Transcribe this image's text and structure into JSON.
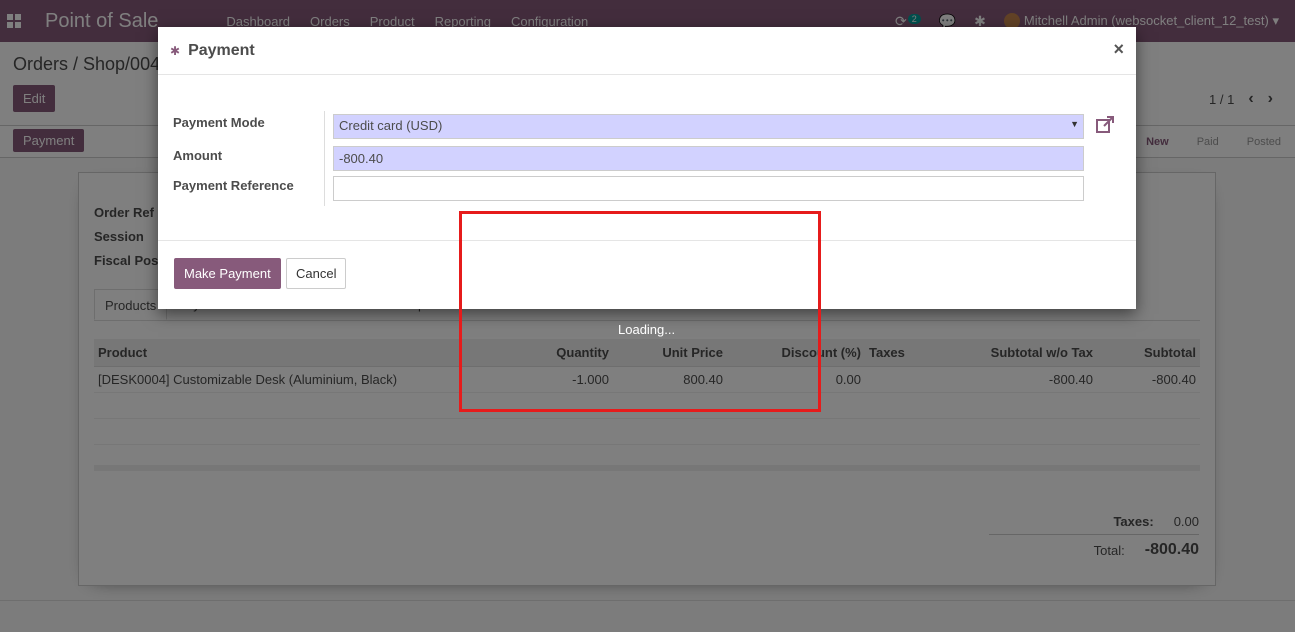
{
  "navbar": {
    "brand": "Point of Sale",
    "menu": [
      "Dashboard",
      "Orders",
      "Product",
      "Reporting",
      "Configuration"
    ],
    "activity_count": "2",
    "user": "Mitchell Admin (websocket_client_12_test)"
  },
  "control_panel": {
    "breadcrumb": "Orders / Shop/004",
    "edit_label": "Edit",
    "pager": "1 / 1"
  },
  "statusbar": {
    "payment_label": "Payment",
    "states": [
      "New",
      "Paid",
      "Posted"
    ]
  },
  "sheet": {
    "labels": {
      "order_ref": "Order Ref",
      "session": "Session",
      "fiscal": "Fiscal Pos"
    },
    "tabs": [
      "Products",
      "Payments",
      "Extra Info",
      "Notes",
      "Receipt Details"
    ],
    "columns": [
      "Product",
      "Quantity",
      "Unit Price",
      "Discount (%)",
      "Taxes",
      "Subtotal w/o Tax",
      "Subtotal"
    ],
    "rows": [
      {
        "product": "[DESK0004] Customizable Desk (Aluminium, Black)",
        "quantity": "-1.000",
        "unit_price": "800.40",
        "discount": "0.00",
        "taxes": "",
        "subtotal_wo_tax": "-800.40",
        "subtotal": "-800.40"
      }
    ],
    "totals": {
      "taxes_label": "Taxes:",
      "taxes_value": "0.00",
      "total_label": "Total:",
      "total_value": "-800.40"
    }
  },
  "modal": {
    "title": "Payment",
    "close": "×",
    "payment_mode_label": "Payment Mode",
    "payment_mode_value": "Credit card (USD)",
    "amount_label": "Amount",
    "amount_value": "-800.40",
    "reference_label": "Payment Reference",
    "reference_value": "",
    "make_payment": "Make Payment",
    "cancel": "Cancel"
  },
  "loading": {
    "text": "Loading..."
  },
  "colors": {
    "brand": "#875a7b",
    "required_field": "#d2d2ff",
    "highlight_box": "#e61b1b"
  }
}
